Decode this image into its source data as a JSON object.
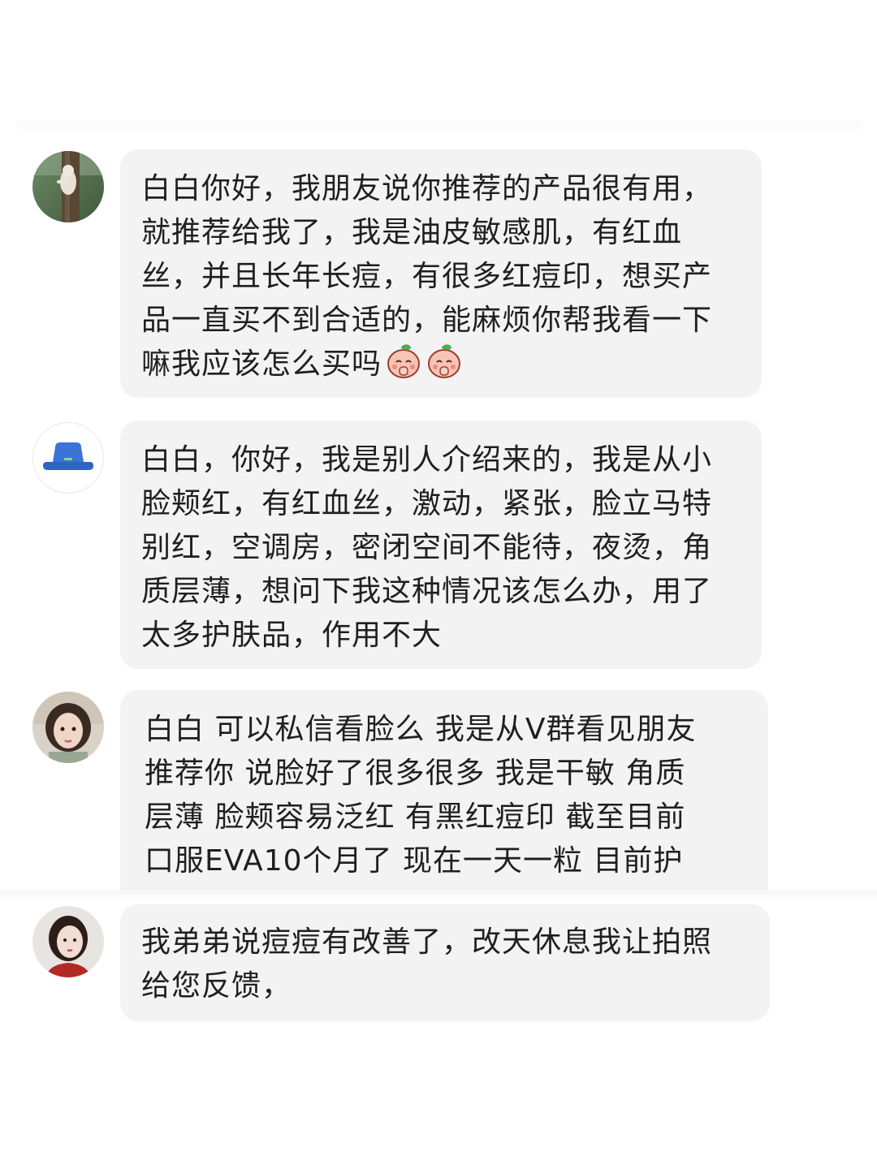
{
  "messages": [
    {
      "avatar": "avatar-tree-cat",
      "lines": [
        "白白你好，我朋友说你推荐的产品很有用，",
        "就推荐给我了，我是油皮敏感肌，有红血",
        "丝，并且长年长痘，有很多红痘印，想买产",
        "品一直买不到合适的，能麻烦你帮我看一下",
        "嘛我应该怎么买吗"
      ],
      "emojis": [
        "praying-peach-emoji",
        "praying-peach-emoji"
      ]
    },
    {
      "avatar": "avatar-blue-bucket-hat",
      "lines": [
        "白白，你好，我是别人介绍来的，我是从小",
        "脸颊红，有红血丝，激动，紧张，脸立马特",
        "别红，空调房，密闭空间不能待，夜烫，角",
        "质层薄，想问下我这种情况该怎么办，用了",
        "太多护肤品，作用不大"
      ]
    },
    {
      "avatar": "avatar-girl-portrait",
      "lines": [
        "白白  可以私信看脸么 我是从V群看见朋友",
        "推荐你 说脸好了很多很多  我是干敏  角质",
        "层薄  脸颊容易泛红  有黑红痘印  截至目前",
        "口服EVA10个月了 现在一天一粒  目前护"
      ]
    },
    {
      "avatar": "avatar-woman-red-top",
      "lines": [
        "我弟弟说痘痘有改善了，改天休息我让拍照",
        "给您反馈，"
      ]
    }
  ],
  "colors": {
    "background": "#ffffff",
    "bubble": "#f3f3f4",
    "text": "#1f1f1f"
  }
}
